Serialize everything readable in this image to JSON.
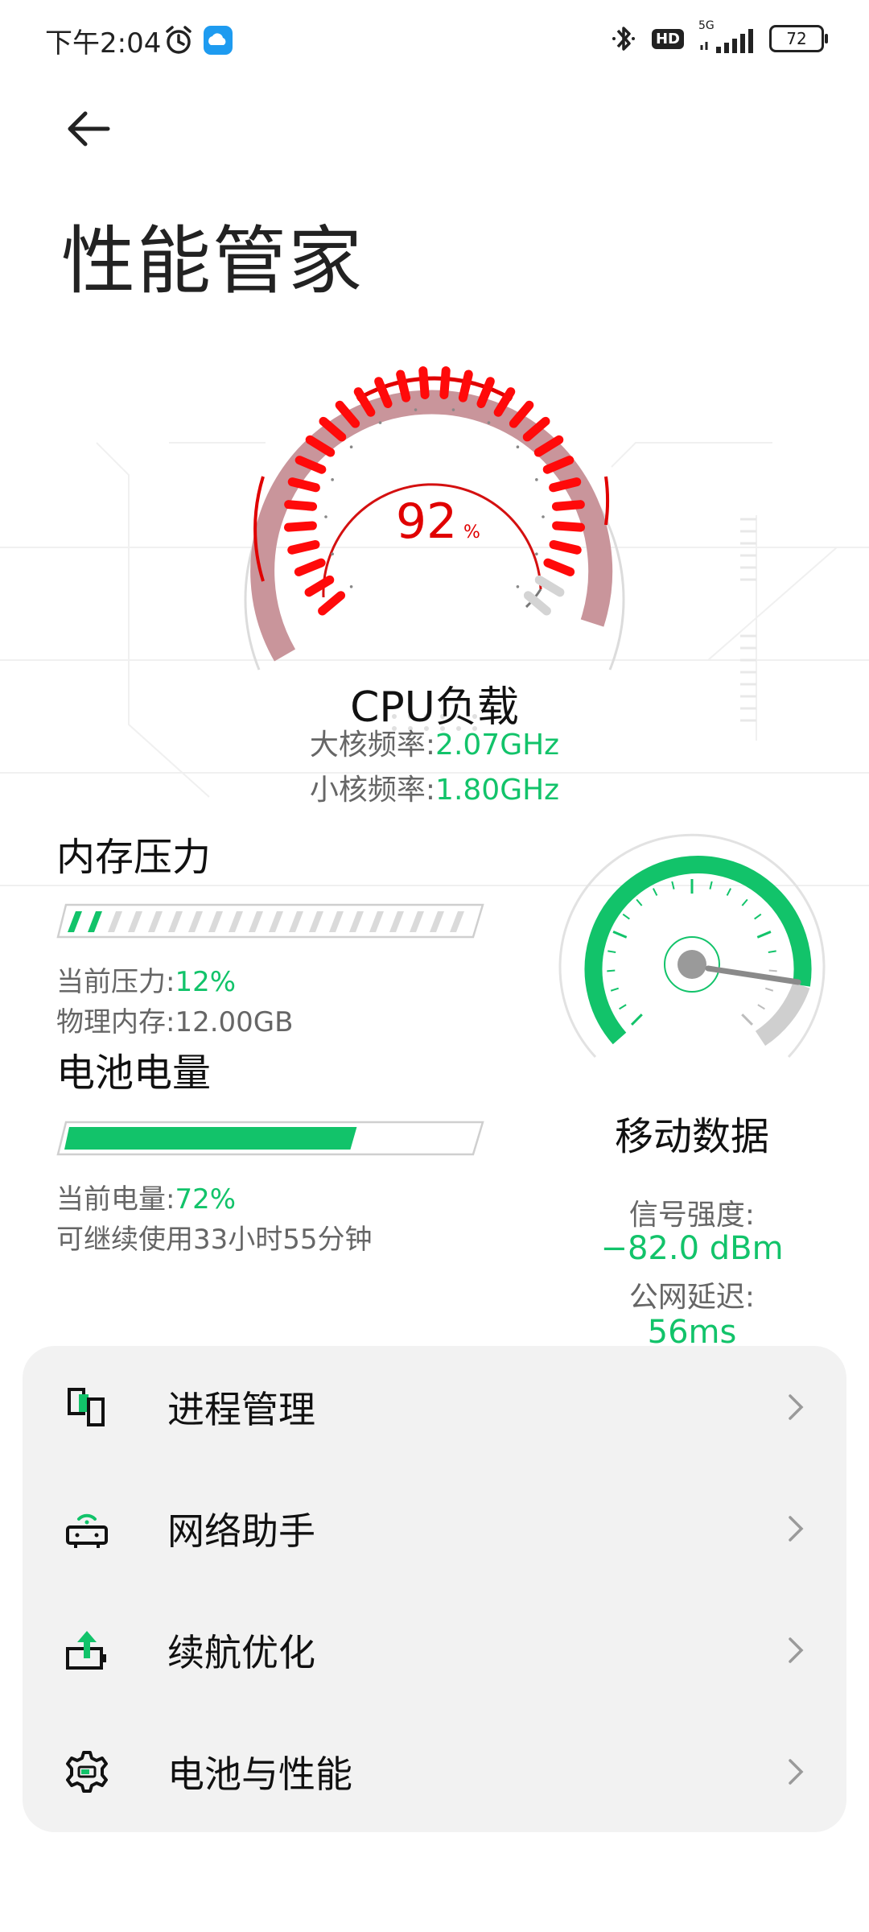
{
  "status_bar": {
    "time": "下午2:04",
    "network": "5G",
    "hd": "HD",
    "battery": "72"
  },
  "page": {
    "title": "性能管家"
  },
  "cpu": {
    "load_value": "92",
    "load_unit": "%",
    "load_percent": 92,
    "title": "CPU负载",
    "big_core_label": "大核频率:",
    "big_core_value": "2.07GHz",
    "small_core_label": "小核频率:",
    "small_core_value": "1.80GHz"
  },
  "memory": {
    "title": "内存压力",
    "pressure_label": "当前压力:",
    "pressure_value": "12%",
    "pressure_fraction": 0.12,
    "physical_label": "物理内存:",
    "physical_value": "12.00GB"
  },
  "battery": {
    "title": "电池电量",
    "level_label": "当前电量:",
    "level_value": "72%",
    "level_fraction": 0.72,
    "remaining": "可继续使用33小时55分钟"
  },
  "network": {
    "title": "移动数据",
    "signal_label": "信号强度:",
    "signal_value": "−82.0 dBm",
    "latency_label": "公网延迟:",
    "latency_value": "56ms"
  },
  "menu": {
    "items": [
      {
        "label": "进程管理",
        "icon": "process-icon"
      },
      {
        "label": "网络助手",
        "icon": "router-icon"
      },
      {
        "label": "续航优化",
        "icon": "battery-boost-icon"
      },
      {
        "label": "电池与性能",
        "icon": "gear-battery-icon"
      }
    ]
  },
  "colors": {
    "accent_green": "#12c36a",
    "cpu_red": "#e00000"
  }
}
